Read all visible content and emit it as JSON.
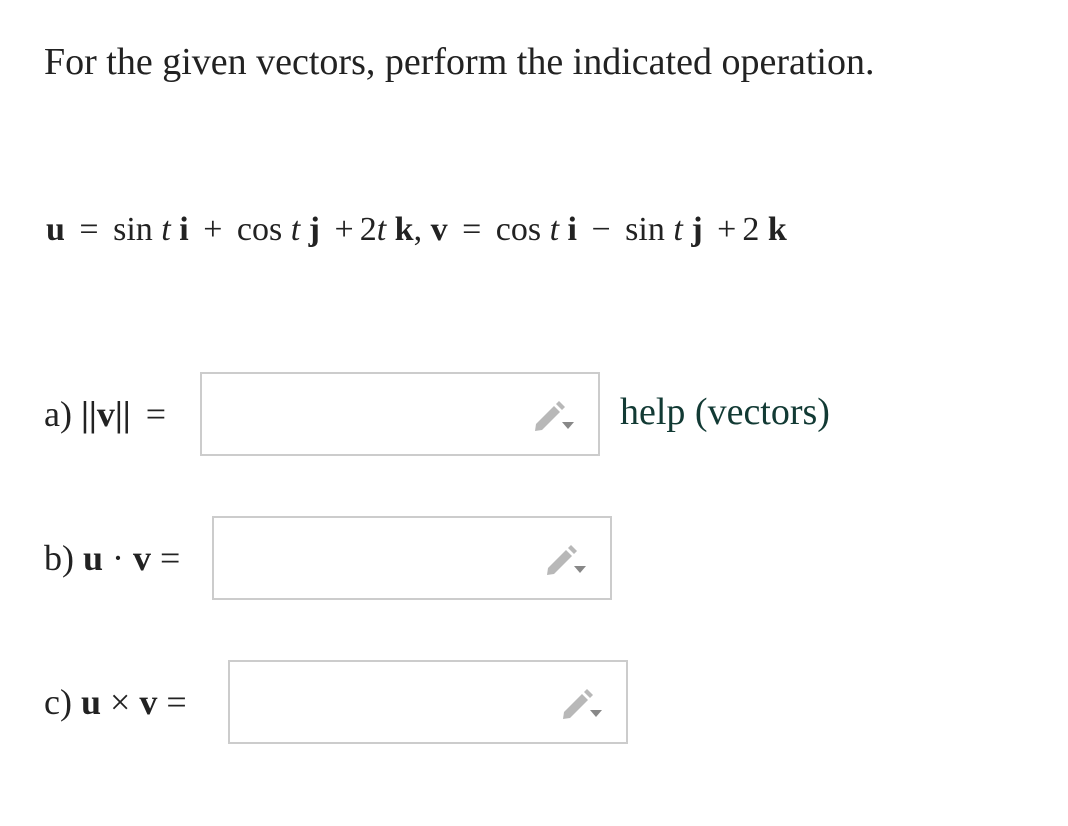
{
  "question": {
    "instruction": "For the given vectors, perform the indicated operation."
  },
  "equation": {
    "u": "u",
    "eq": "=",
    "sin": "sin",
    "t": "t",
    "i": "i",
    "plus": "+",
    "cos": "cos",
    "j": "j",
    "two": "2",
    "k": "k",
    "comma": ",",
    "v": "v",
    "minus": "−"
  },
  "parts": [
    {
      "label_prefix": "a)",
      "label_expr": "||v||",
      "equals": "=",
      "value": ""
    },
    {
      "label_prefix": "b)",
      "label_u": "u",
      "operator": "·",
      "label_v": "v",
      "equals": "=",
      "value": ""
    },
    {
      "label_prefix": "c)",
      "label_u": "u",
      "operator": "×",
      "label_v": "v",
      "equals": "=",
      "value": ""
    }
  ],
  "help": {
    "label": "help (vectors)"
  },
  "icons": {
    "edit": "pencil-dropdown-icon"
  },
  "colors": {
    "text": "#222222",
    "box_border": "#cccccc",
    "icon": "#b0b0b0",
    "help_link": "#123a34"
  }
}
